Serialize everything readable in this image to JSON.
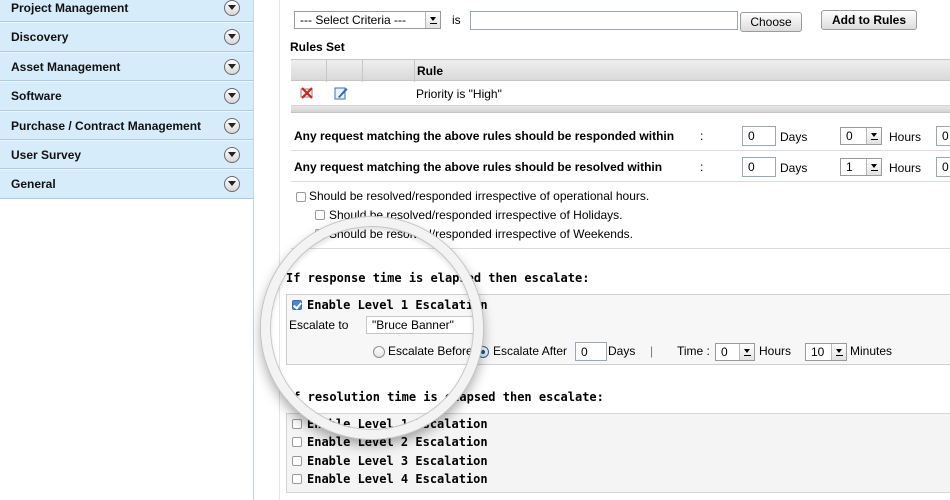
{
  "sidebar": {
    "items": [
      {
        "label": "Project Management"
      },
      {
        "label": "Discovery"
      },
      {
        "label": "Asset Management"
      },
      {
        "label": "Software"
      },
      {
        "label": "Purchase / Contract Management"
      },
      {
        "label": "User Survey"
      },
      {
        "label": "General"
      }
    ]
  },
  "criteria": {
    "select_value": "--- Select Criteria ---",
    "is_label": "is",
    "value_input": "",
    "choose_label": "Choose",
    "add_label": "Add to Rules"
  },
  "rules": {
    "title": "Rules Set",
    "col_rule": "Rule",
    "rows": [
      {
        "rule": "Priority is \"High\""
      }
    ]
  },
  "sla": {
    "respond_label": "Any request matching the above rules should be responded within",
    "resolve_label": "Any request matching the above rules should be resolved within",
    "colon": ":",
    "respond_days": "0",
    "respond_hours": "0",
    "resolve_days": "0",
    "resolve_hours": "1",
    "days_label": "Days",
    "hours_label": "Hours",
    "minutes_partial": "0"
  },
  "options": {
    "operational": "Should be resolved/responded irrespective of operational hours.",
    "holidays": "Should be resolved/responded irrespective of Holidays.",
    "weekends": "Should be resolved/responded irrespective of Weekends."
  },
  "response_escalation": {
    "title": "If response time is elapsed then escalate:",
    "level1_label": "Enable Level 1 Escalation",
    "level1_checked": true,
    "escalate_to_label": "Escalate to",
    "escalate_to_value": "\"Bruce Banner\"",
    "before_label": "Escalate Before",
    "after_label": "Escalate After",
    "after_selected": true,
    "days_value": "0",
    "days_label": "Days",
    "divider": "|",
    "time_label": "Time :",
    "hours_value": "0",
    "hours_label": "Hours",
    "minutes_value": "10",
    "minutes_label": "Minutes"
  },
  "resolution_escalation": {
    "title": "If resolution time is elapsed then escalate:",
    "levels": [
      {
        "label": "Enable Level 1 Escalation"
      },
      {
        "label": "Enable Level 2 Escalation"
      },
      {
        "label": "Enable Level 3 Escalation"
      },
      {
        "label": "Enable Level 4 Escalation"
      }
    ]
  }
}
